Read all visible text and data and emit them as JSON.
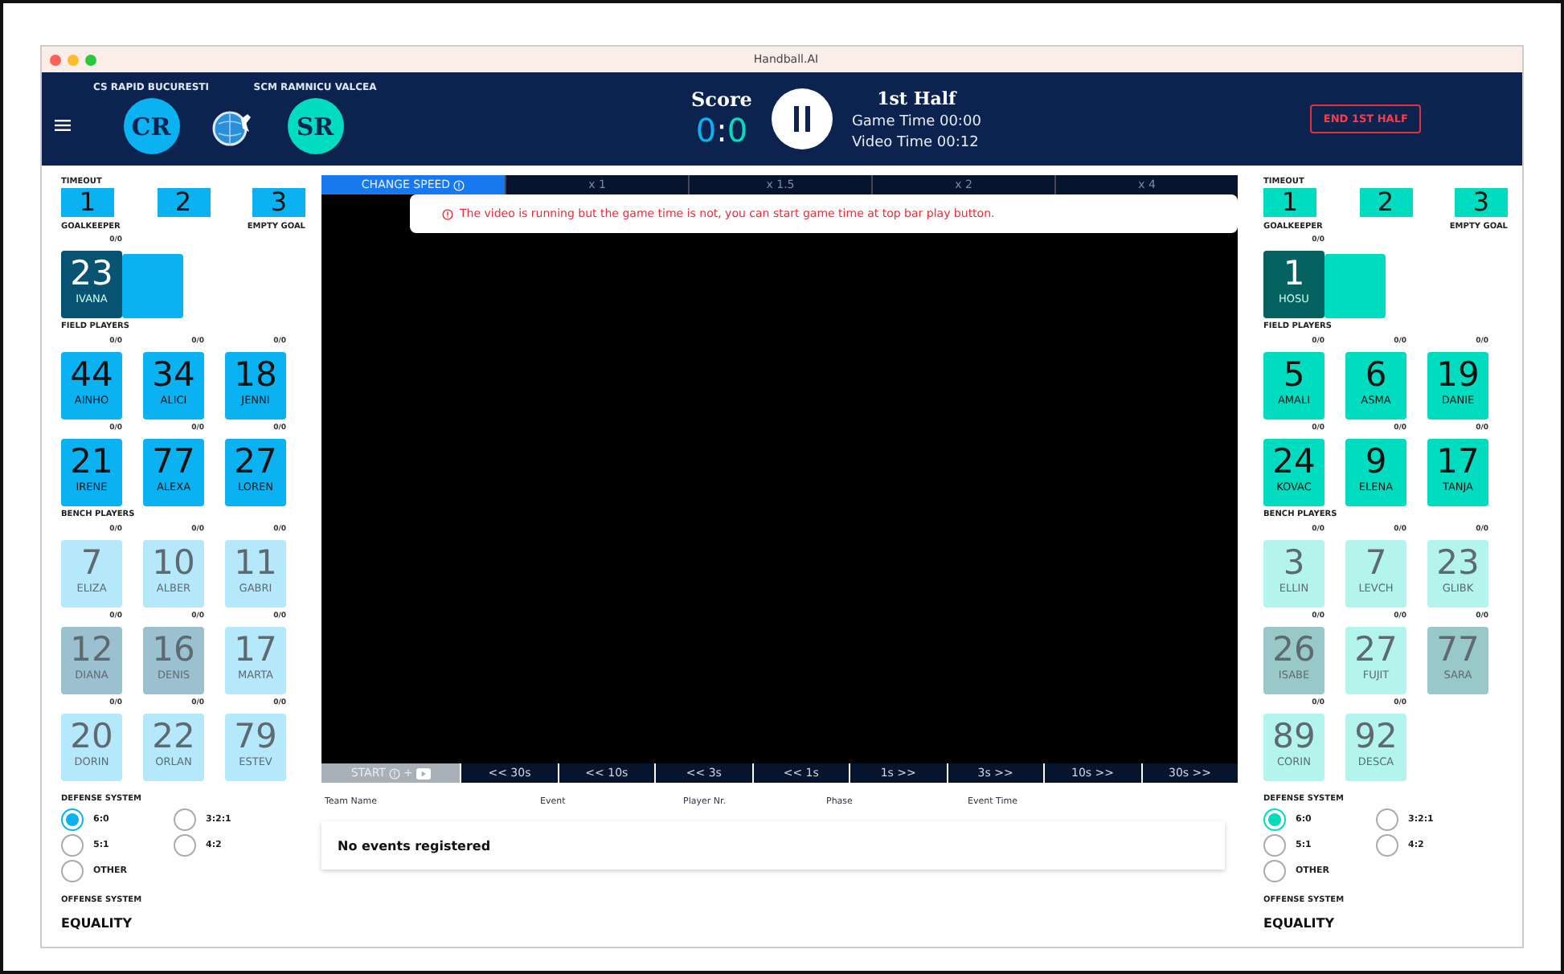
{
  "window": {
    "title": "Handball.AI"
  },
  "header": {
    "teams": [
      {
        "name": "CS RAPID BUCURESTI",
        "initials": "CR"
      },
      {
        "name": "SCM RAMNICU VALCEA",
        "initials": "SR"
      }
    ],
    "score": {
      "label": "Score",
      "home": "0",
      "separator": ":",
      "away": "0"
    },
    "period": "1st Half",
    "game_time": "Game Time 00:00",
    "video_time": "Video Time 00:12",
    "end_button": "END 1ST HALF"
  },
  "teams": [
    {
      "color": "#0ab2f2",
      "timeout_label": "TIMEOUT",
      "timeouts": [
        "1",
        "2",
        "3"
      ],
      "goalkeeper_label": "GOALKEEPER",
      "empty_goal_label": "EMPTY GOAL",
      "goalkeepers": [
        {
          "number": "23",
          "name": "IVANA",
          "stat": "0/0",
          "selected": true
        }
      ],
      "field_label": "FIELD PLAYERS",
      "field_players": [
        {
          "number": "44",
          "name": "AINHO",
          "stat": "0/0"
        },
        {
          "number": "34",
          "name": "ALICI",
          "stat": "0/0"
        },
        {
          "number": "18",
          "name": "JENNI",
          "stat": "0/0"
        },
        {
          "number": "21",
          "name": "IRENE",
          "stat": "0/0"
        },
        {
          "number": "77",
          "name": "ALEXA",
          "stat": "0/0"
        },
        {
          "number": "27",
          "name": "LOREN",
          "stat": "0/0"
        }
      ],
      "bench_label": "BENCH PLAYERS",
      "bench_players": [
        {
          "number": "7",
          "name": "ELIZA",
          "stat": "0/0",
          "excluded": false
        },
        {
          "number": "10",
          "name": "ALBER",
          "stat": "0/0",
          "excluded": false
        },
        {
          "number": "11",
          "name": "GABRI",
          "stat": "0/0",
          "excluded": false
        },
        {
          "number": "12",
          "name": "DIANA",
          "stat": "0/0",
          "excluded": true
        },
        {
          "number": "16",
          "name": "DENIS",
          "stat": "0/0",
          "excluded": true
        },
        {
          "number": "17",
          "name": "MARTA",
          "stat": "0/0",
          "excluded": false
        },
        {
          "number": "20",
          "name": "DORIN",
          "stat": "0/0",
          "excluded": false
        },
        {
          "number": "22",
          "name": "ORLAN",
          "stat": "0/0",
          "excluded": false
        },
        {
          "number": "79",
          "name": "ESTEV",
          "stat": "0/0",
          "excluded": false
        }
      ],
      "defense_label": "DEFENSE SYSTEM",
      "defense_options": [
        {
          "label": "6:0",
          "selected": true
        },
        {
          "label": "3:2:1",
          "selected": false
        },
        {
          "label": "5:1",
          "selected": false
        },
        {
          "label": "4:2",
          "selected": false
        },
        {
          "label": "OTHER",
          "selected": false
        }
      ],
      "offense_label": "OFFENSE SYSTEM",
      "offense_value": "EQUALITY"
    },
    {
      "color": "#00dcc0",
      "timeout_label": "TIMEOUT",
      "timeouts": [
        "1",
        "2",
        "3"
      ],
      "goalkeeper_label": "GOALKEEPER",
      "empty_goal_label": "EMPTY GOAL",
      "goalkeepers": [
        {
          "number": "1",
          "name": "HOSU",
          "stat": "0/0",
          "selected": true
        }
      ],
      "field_label": "FIELD PLAYERS",
      "field_players": [
        {
          "number": "5",
          "name": "AMALI",
          "stat": "0/0"
        },
        {
          "number": "6",
          "name": "ASMA",
          "stat": "0/0"
        },
        {
          "number": "19",
          "name": "DANIE",
          "stat": "0/0"
        },
        {
          "number": "24",
          "name": "KOVAC",
          "stat": "0/0"
        },
        {
          "number": "9",
          "name": "ELENA",
          "stat": "0/0"
        },
        {
          "number": "17",
          "name": "TANJA",
          "stat": "0/0"
        }
      ],
      "bench_label": "BENCH PLAYERS",
      "bench_players": [
        {
          "number": "3",
          "name": "ELLIN",
          "stat": "0/0",
          "excluded": false
        },
        {
          "number": "7",
          "name": "LEVCH",
          "stat": "0/0",
          "excluded": false
        },
        {
          "number": "23",
          "name": "GLIBK",
          "stat": "0/0",
          "excluded": false
        },
        {
          "number": "26",
          "name": "ISABE",
          "stat": "0/0",
          "excluded": true
        },
        {
          "number": "27",
          "name": "FUJIT",
          "stat": "0/0",
          "excluded": false
        },
        {
          "number": "77",
          "name": "SARA",
          "stat": "0/0",
          "excluded": true
        },
        {
          "number": "89",
          "name": "CORIN",
          "stat": "0/0",
          "excluded": false
        },
        {
          "number": "92",
          "name": "DESCA",
          "stat": "0/0",
          "excluded": false
        }
      ],
      "defense_label": "DEFENSE SYSTEM",
      "defense_options": [
        {
          "label": "6:0",
          "selected": true
        },
        {
          "label": "3:2:1",
          "selected": false
        },
        {
          "label": "5:1",
          "selected": false
        },
        {
          "label": "4:2",
          "selected": false
        },
        {
          "label": "OTHER",
          "selected": false
        }
      ],
      "offense_label": "OFFENSE SYSTEM",
      "offense_value": "EQUALITY"
    }
  ],
  "video": {
    "speed_label": "CHANGE SPEED",
    "speeds": [
      "x 1",
      "x 1.5",
      "x 2",
      "x 4"
    ],
    "alert": "The video is running but the game time is not, you can start game time at top bar play button.",
    "start_label": "START",
    "start_plus": "+",
    "seek_buttons": [
      "<< 30s",
      "<< 10s",
      "<< 3s",
      "<< 1s",
      "1s >>",
      "3s >>",
      "10s >>",
      "30s >>"
    ]
  },
  "events": {
    "columns": [
      "Team Name",
      "Event",
      "Player Nr.",
      "Phase",
      "Event Time"
    ],
    "empty_message": "No events registered"
  }
}
